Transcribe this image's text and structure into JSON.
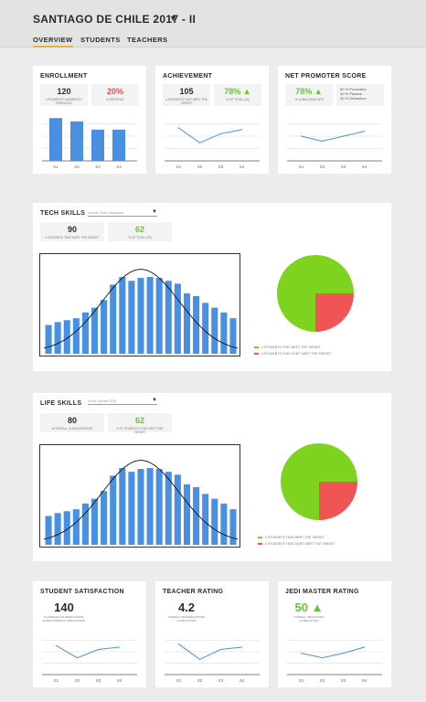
{
  "header": {
    "title": "SANTIAGO DE CHILE 2017 - II",
    "caret": "▼",
    "tabs": [
      {
        "label": "OVERVIEW",
        "active": true
      },
      {
        "label": "STUDENTS",
        "active": false
      },
      {
        "label": "TEACHERS",
        "active": false
      }
    ]
  },
  "enrollment": {
    "title": "ENROLLMENT",
    "stat1": {
      "value": "120",
      "label": "# STUDENTS CURRENTLY ENROLLED"
    },
    "stat2": {
      "value": "20%",
      "label": "% DROPOUT"
    }
  },
  "achievement": {
    "title": "ACHIEVEMENT",
    "stat1": {
      "value": "105",
      "label": "# STUDENTS THAT MEET THE TARGET"
    },
    "stat2": {
      "value": "78% ▲",
      "label": "% OF TOTAL (20)"
    }
  },
  "nps": {
    "title": "NET PROMOTER SCORE",
    "stat1": {
      "value": "78% ▲",
      "label": "% CUMULATIVE NPS"
    },
    "notes": [
      "60 % Promoters",
      "20 % Passive",
      "30 % Detractors"
    ]
  },
  "tech": {
    "title": "TECH SKILLS",
    "select_placeholder": "overall Team Adoption",
    "stat1": {
      "value": "90",
      "label": "# STUDENTS THAT MEET THE TARGET"
    },
    "stat2": {
      "value": "62",
      "label": "% OF TOTAL (22)"
    },
    "legend": [
      "# STUDENTS THAT MEET THE TARGET",
      "# STUDENTS THAT DON'T MEET THE TARGET"
    ]
  },
  "life": {
    "title": "LIFE SKILLS",
    "select_placeholder": "Grow Speed (SS)",
    "stat1": {
      "value": "80",
      "label": "# OVERALL CLASS AVERAGE"
    },
    "stat2": {
      "value": "62",
      "label": "# OF STUDENTS THAT MEET THE TARGET"
    },
    "legend": [
      "# STUDENTS THAT MEET THE TARGET",
      "# STUDENTS THAT DON'T MEET THE TARGET"
    ]
  },
  "satisfaction": {
    "title": "STUDENT SATISFACTION",
    "value": "140",
    "label": "% AVERAGE OF DEDICATIONS, EXPECTATIONS & SIMULATIONS"
  },
  "teacher": {
    "title": "TEACHER RATING",
    "value": "4.2",
    "label": "OVERALL TEACHER RATING (CUMULATIVE)"
  },
  "jedi": {
    "title": "JEDI MASTER RATING",
    "value": "50 ▲",
    "label": "OVERALL JEDI RATING (CUMULATIVE)"
  },
  "colors": {
    "blue": "#4a90e2",
    "green": "#7ed321",
    "red": "#f05454",
    "accent": "#e8b23a"
  },
  "chart_data": [
    {
      "type": "bar",
      "id": "enrollment",
      "categories": [
        "S1",
        "S2",
        "S3",
        "S4"
      ],
      "values": [
        52,
        48,
        38,
        38
      ],
      "ylim": [
        0,
        60
      ]
    },
    {
      "type": "line",
      "id": "achievement",
      "categories": [
        "S1",
        "S2",
        "S3",
        "S4"
      ],
      "values": [
        40,
        22,
        33,
        38
      ],
      "ylim": [
        0,
        60
      ]
    },
    {
      "type": "line",
      "id": "nps",
      "categories": [
        "S1",
        "S2",
        "S3",
        "S4"
      ],
      "values": [
        30,
        24,
        30,
        36
      ],
      "ylim": [
        0,
        60
      ]
    },
    {
      "type": "bar",
      "id": "tech_hist",
      "values": [
        30,
        33,
        35,
        37,
        43,
        48,
        56,
        72,
        80,
        76,
        79,
        80,
        79,
        76,
        73,
        63,
        60,
        53,
        48,
        43,
        37
      ],
      "ylim": [
        0,
        100
      ],
      "overlay": "normal-curve"
    },
    {
      "type": "pie",
      "id": "tech_pie",
      "values": [
        75,
        25
      ],
      "labels": [
        "MEET",
        "DON'T MEET"
      ]
    },
    {
      "type": "bar",
      "id": "life_hist",
      "values": [
        30,
        33,
        35,
        37,
        43,
        48,
        56,
        72,
        80,
        76,
        79,
        80,
        79,
        76,
        73,
        63,
        60,
        53,
        48,
        43,
        37
      ],
      "ylim": [
        0,
        100
      ],
      "overlay": "normal-curve"
    },
    {
      "type": "pie",
      "id": "life_pie",
      "values": [
        75,
        25
      ],
      "labels": [
        "MEET",
        "DON'T MEET"
      ]
    },
    {
      "type": "line",
      "id": "satisfaction",
      "categories": [
        "S1",
        "S2",
        "S3",
        "S4"
      ],
      "values": [
        38,
        22,
        33,
        36
      ],
      "ylim": [
        0,
        60
      ]
    },
    {
      "type": "line",
      "id": "teacher",
      "categories": [
        "S1",
        "S2",
        "S3",
        "S4"
      ],
      "values": [
        40,
        20,
        33,
        36
      ],
      "ylim": [
        0,
        60
      ]
    },
    {
      "type": "line",
      "id": "jedi",
      "categories": [
        "S1",
        "S2",
        "S3",
        "S4"
      ],
      "values": [
        28,
        22,
        28,
        36
      ],
      "ylim": [
        0,
        60
      ]
    }
  ]
}
